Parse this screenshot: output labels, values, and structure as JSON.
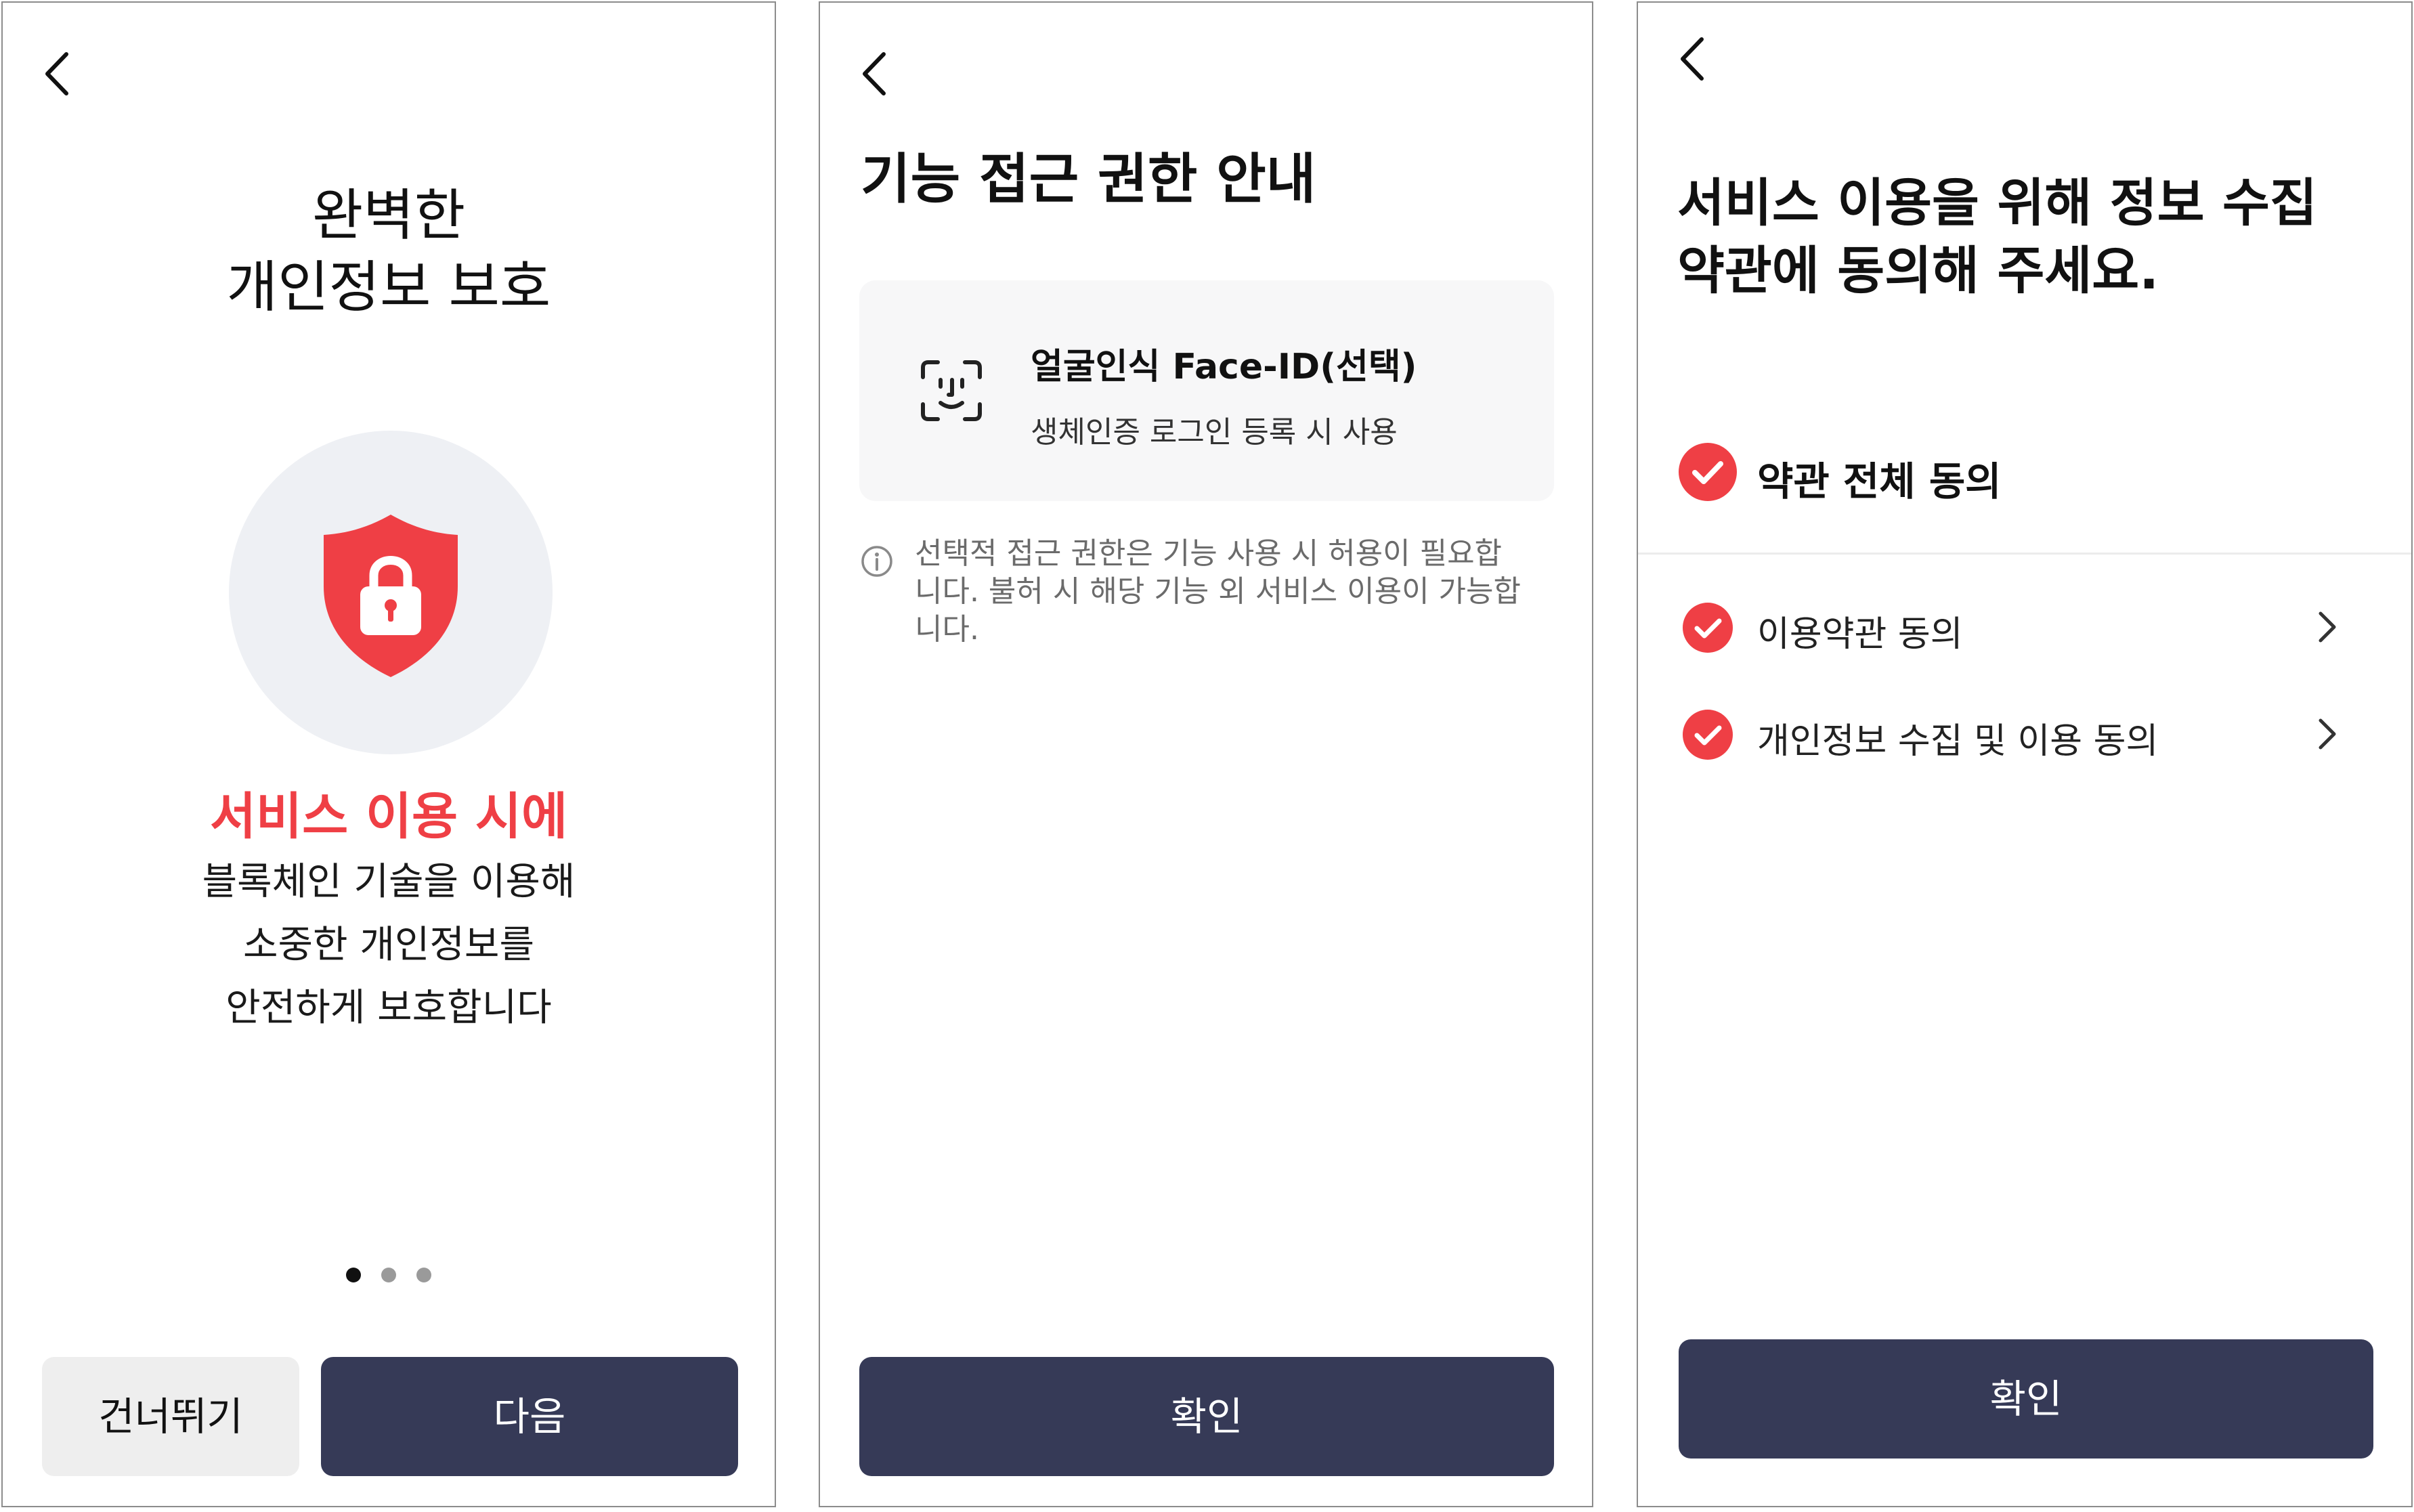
{
  "colors": {
    "accent_red": "#ef3f45",
    "button_navy": "#363a57",
    "button_grey": "#eeeeee",
    "card_bg": "#f7f7f8",
    "circle_bg": "#eef0f4"
  },
  "icons": {
    "back": "chevron-left-icon",
    "shield": "shield-lock-icon",
    "face_id": "face-id-icon",
    "info": "info-icon",
    "check": "check-circle-icon",
    "chevron": "chevron-right-icon"
  },
  "screen1": {
    "title_line1": "완벽한",
    "title_line2": "개인정보 보호",
    "highlight": "서비스 이용 시에",
    "desc_line1": "블록체인 기술을 이용해",
    "desc_line2": "소중한 개인정보를",
    "desc_line3": "안전하게 보호합니다",
    "page_indicator": {
      "current": 1,
      "total": 3
    },
    "skip_label": "건너뛰기",
    "next_label": "다음"
  },
  "screen2": {
    "title": "기능 접근 권한 안내",
    "permission": {
      "name": "얼굴인식 Face-ID(선택)",
      "description": "생체인증 로그인 등록 시 사용"
    },
    "notice": "선택적 접근 권한은 기능 사용 시 허용이 필요합니다. 불허 시 해당 기능 외 서비스 이용이 가능합니다.",
    "confirm_label": "확인"
  },
  "screen3": {
    "title_line1": "서비스 이용을 위해 정보 수집",
    "title_line2": "약관에 동의해 주세요.",
    "agree_all": {
      "label": "약관 전체 동의",
      "checked": true
    },
    "items": [
      {
        "label": "이용약관 동의",
        "checked": true
      },
      {
        "label": "개인정보 수집 및 이용 동의",
        "checked": true
      }
    ],
    "confirm_label": "확인"
  }
}
